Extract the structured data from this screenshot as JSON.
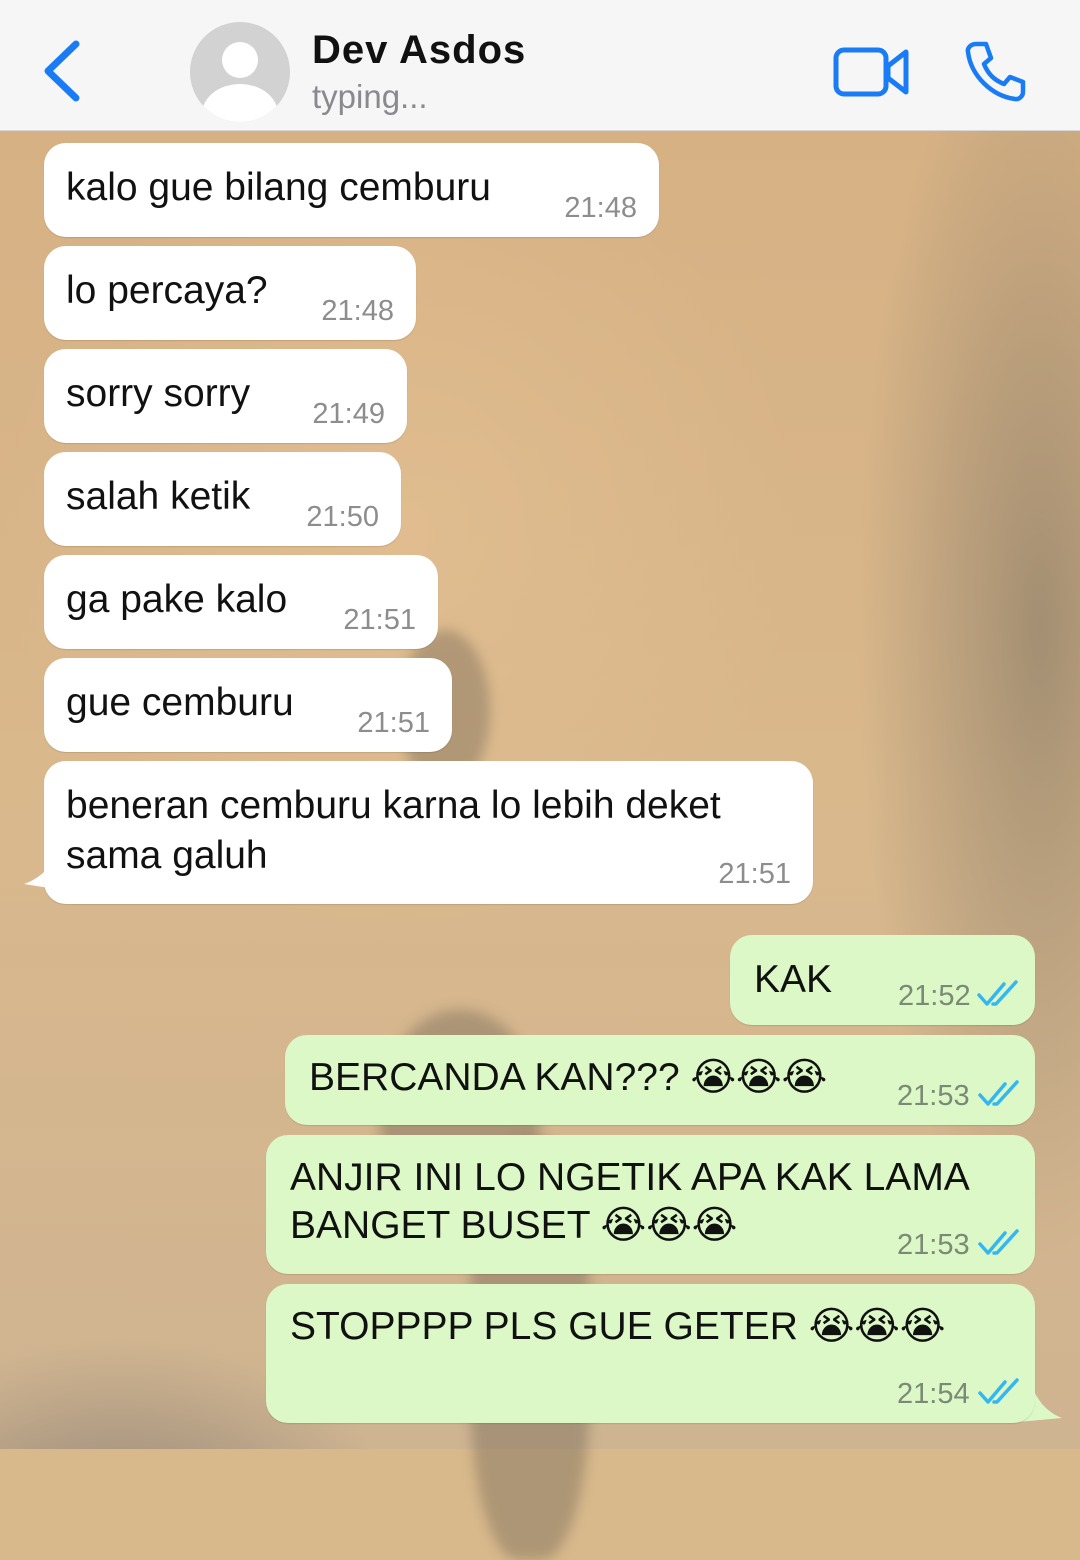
{
  "header": {
    "contact_name": "Dev Asdos",
    "status": "typing...",
    "accent_color": "#1a7cf5",
    "icons": [
      "chevron-left-icon",
      "avatar-placeholder-icon",
      "video-camera-icon",
      "phone-icon"
    ]
  },
  "messages": [
    {
      "direction": "incoming",
      "text": "kalo gue bilang cemburu",
      "time": "21:48"
    },
    {
      "direction": "incoming",
      "text": "lo percaya?",
      "time": "21:48"
    },
    {
      "direction": "incoming",
      "text": "sorry sorry",
      "time": "21:49"
    },
    {
      "direction": "incoming",
      "text": "salah ketik",
      "time": "21:50"
    },
    {
      "direction": "incoming",
      "text": "ga pake kalo",
      "time": "21:51"
    },
    {
      "direction": "incoming",
      "text": "gue cemburu",
      "time": "21:51"
    },
    {
      "direction": "incoming",
      "text_line1": "beneran cemburu karna lo lebih deket",
      "text_line2": "sama galuh",
      "time": "21:51"
    },
    {
      "direction": "outgoing",
      "text": "KAK",
      "time": "21:52",
      "status": "read"
    },
    {
      "direction": "outgoing",
      "text": "BERCANDA KAN??? 😭😭😭",
      "time": "21:53",
      "status": "read"
    },
    {
      "direction": "outgoing",
      "text_line1": "ANJIR INI LO NGETIK APA KAK LAMA",
      "text_line2": "BANGET BUSET 😭😭😭",
      "time": "21:53",
      "status": "read"
    },
    {
      "direction": "outgoing",
      "text": "STOPPPP PLS GUE GETER 😭😭😭",
      "time": "21:54",
      "status": "read"
    }
  ],
  "colors": {
    "incoming_bubble": "#ffffff",
    "outgoing_bubble": "#dcf8c6",
    "read_ticks": "#34b7f1"
  }
}
